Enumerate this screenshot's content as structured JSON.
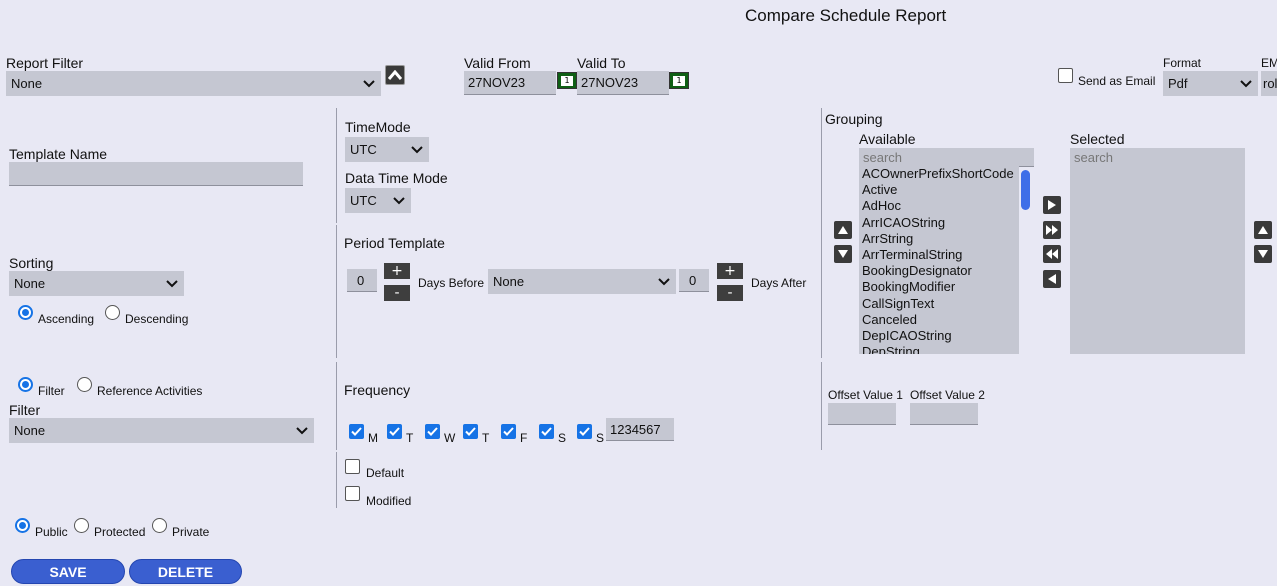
{
  "page_title": "Compare Schedule Report",
  "report_filter": {
    "label": "Report Filter",
    "value": "None"
  },
  "valid_from": {
    "label": "Valid From",
    "value": "27NOV23"
  },
  "valid_to": {
    "label": "Valid To",
    "value": "27NOV23"
  },
  "calendar_day": "1",
  "send_as_email": {
    "label": "Send as Email",
    "checked": false
  },
  "format": {
    "label": "Format",
    "value": "Pdf"
  },
  "email": {
    "label": "EM",
    "value": "rol"
  },
  "template_name": {
    "label": "Template Name",
    "value": ""
  },
  "time_mode": {
    "label": "TimeMode",
    "value": "UTC"
  },
  "data_time_mode": {
    "label": "Data Time Mode",
    "value": "UTC"
  },
  "grouping": {
    "label": "Grouping",
    "available_label": "Available",
    "selected_label": "Selected",
    "available_search_placeholder": "search",
    "selected_search_placeholder": "search",
    "available_items": [
      "ACOwnerPrefixShortCode",
      "Active",
      "AdHoc",
      "ArrICAOString",
      "ArrString",
      "ArrTerminalString",
      "BookingDesignator",
      "BookingModifier",
      "CallSignText",
      "Canceled",
      "DepICAOString",
      "DepString"
    ]
  },
  "sorting": {
    "label": "Sorting",
    "value": "None",
    "ascending_label": "Ascending",
    "descending_label": "Descending",
    "selected": "ascending"
  },
  "period_template": {
    "label": "Period Template",
    "days_before_value": "0",
    "days_before_label": "Days Before",
    "template_value": "None",
    "days_after_value": "0",
    "days_after_label": "Days After",
    "plus": "+",
    "minus": "-"
  },
  "filter_mode": {
    "filter_label": "Filter",
    "reference_label": "Reference Activities",
    "selected": "filter"
  },
  "filter": {
    "label": "Filter",
    "value": "None"
  },
  "frequency": {
    "label": "Frequency",
    "days": [
      {
        "letter": "M",
        "checked": true
      },
      {
        "letter": "T",
        "checked": true
      },
      {
        "letter": "W",
        "checked": true
      },
      {
        "letter": "T",
        "checked": true
      },
      {
        "letter": "F",
        "checked": true
      },
      {
        "letter": "S",
        "checked": true
      },
      {
        "letter": "S",
        "checked": true
      }
    ],
    "value": "1234567"
  },
  "offset": {
    "value1_label": "Offset Value 1",
    "value2_label": "Offset Value 2",
    "value1": "",
    "value2": ""
  },
  "flags": {
    "default_label": "Default",
    "modified_label": "Modified",
    "default_checked": false,
    "modified_checked": false
  },
  "visibility": {
    "public_label": "Public",
    "protected_label": "Protected",
    "private_label": "Private",
    "selected": "public"
  },
  "buttons": {
    "save": "SAVE",
    "delete": "DELETE"
  },
  "colors": {
    "accent": "#1673e6",
    "button_bg": "#3a5fd0",
    "field_bg": "#c5c7d2",
    "page_bg": "#e8e8f4"
  }
}
